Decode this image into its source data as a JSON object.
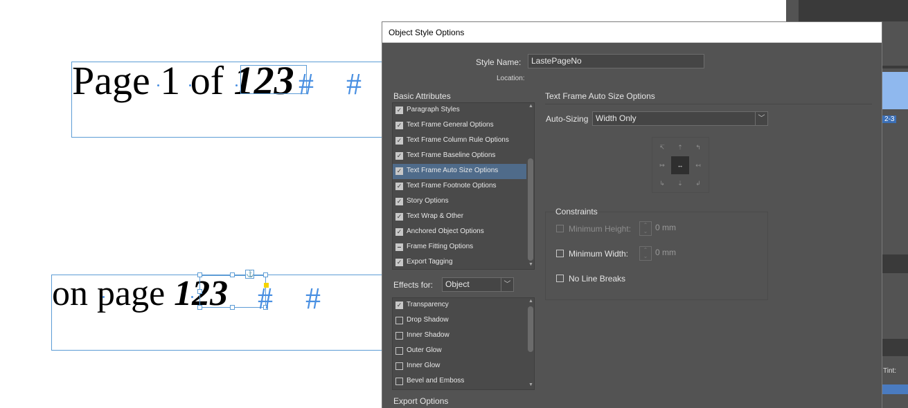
{
  "document": {
    "line1": {
      "text": "Page 1 of ",
      "bold_number": "123"
    },
    "line2": {
      "text": "on page ",
      "bold_number": "123"
    },
    "hash_symbol": "#",
    "anchor_icon": "anchor-icon"
  },
  "dialog": {
    "title": "Object Style Options",
    "style_name_label": "Style Name:",
    "style_name_value": "LastePageNo",
    "location_label": "Location:",
    "basic_attributes_header": "Basic Attributes",
    "basic_attributes": [
      {
        "label": "Paragraph Styles",
        "state": "checked"
      },
      {
        "label": "Text Frame General Options",
        "state": "checked"
      },
      {
        "label": "Text Frame Column Rule Options",
        "state": "checked"
      },
      {
        "label": "Text Frame Baseline Options",
        "state": "checked"
      },
      {
        "label": "Text Frame Auto Size Options",
        "state": "checked",
        "selected": true
      },
      {
        "label": "Text Frame Footnote Options",
        "state": "checked"
      },
      {
        "label": "Story Options",
        "state": "checked"
      },
      {
        "label": "Text Wrap & Other",
        "state": "checked"
      },
      {
        "label": "Anchored Object Options",
        "state": "checked"
      },
      {
        "label": "Frame Fitting Options",
        "state": "mixed"
      },
      {
        "label": "Export Tagging",
        "state": "checked"
      }
    ],
    "effects_for_label": "Effects for:",
    "effects_for_value": "Object",
    "effects": [
      {
        "label": "Transparency",
        "state": "checked"
      },
      {
        "label": "Drop Shadow",
        "state": "unchecked"
      },
      {
        "label": "Inner Shadow",
        "state": "unchecked"
      },
      {
        "label": "Outer Glow",
        "state": "unchecked"
      },
      {
        "label": "Inner Glow",
        "state": "unchecked"
      },
      {
        "label": "Bevel and Emboss",
        "state": "unchecked"
      }
    ],
    "export_options_header": "Export Options",
    "panel_title": "Text Frame Auto Size Options",
    "auto_sizing_label": "Auto-Sizing",
    "auto_sizing_value": "Width Only",
    "reference_point_icons": [
      "arrow-topleft-icon",
      "arrow-top-icon",
      "arrow-topright-icon",
      "arrow-left-icon",
      "arrow-center-icon",
      "arrow-right-icon",
      "arrow-bottomleft-icon",
      "arrow-bottom-icon",
      "arrow-bottomright-icon"
    ],
    "constraints_header": "Constraints",
    "min_height_label": "Minimum Height:",
    "min_height_value": "0 mm",
    "min_width_label": "Minimum Width:",
    "min_width_value": "0 mm",
    "no_line_breaks_label": "No Line Breaks"
  },
  "background_panel": {
    "tint_label": "Tint:",
    "page_label": "2-3"
  },
  "colors": {
    "frame_blue": "#5b9bd5",
    "dialog_bg": "#535353",
    "selection_blue": "#4f6b8a"
  }
}
